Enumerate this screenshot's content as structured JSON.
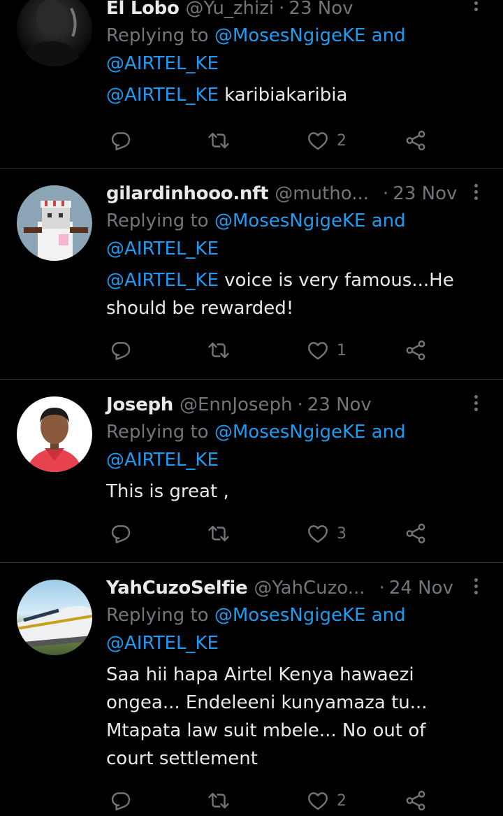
{
  "tweets": [
    {
      "name": "Èl Lobo",
      "handle": "@Yu_zhizi",
      "date": "23 Nov",
      "replying_prefix": "Replying to",
      "mention1": "@MosesNgigeKE",
      "and": "and",
      "mention2": "@AIRTEL_KE",
      "body_mention": "@AIRTEL_KE",
      "body": "karibiakaribia",
      "likes": "2"
    },
    {
      "name": "gilardinhooo.nft",
      "handle": "@mutho...",
      "date": "23 Nov",
      "replying_prefix": "Replying to",
      "mention1": "@MosesNgigeKE",
      "and": "and",
      "mention2": "@AIRTEL_KE",
      "body_mention": "@AIRTEL_KE",
      "body": "voice is very famous...He should be rewarded!",
      "likes": "1"
    },
    {
      "name": "Joseph",
      "handle": "@EnnJoseph",
      "date": "23 Nov",
      "replying_prefix": "Replying to",
      "mention1": "@MosesNgigeKE",
      "and": "and",
      "mention2": "@AIRTEL_KE",
      "body_mention": "",
      "body": "This is great ,",
      "likes": "3"
    },
    {
      "name": "YahCuzoSelfie",
      "handle": "@YahCuzo...",
      "date": "24 Nov",
      "replying_prefix": "Replying to",
      "mention1": "@MosesNgigeKE",
      "and": "and",
      "mention2": "@AIRTEL_KE",
      "body_mention": "",
      "body": "Saa hii hapa Airtel Kenya hawaezi ongea... Endeleeni kunyamaza tu... Mtapata law suit mbele... No out of court settlement",
      "likes": "2"
    }
  ],
  "icons": {
    "reply": "reply-icon",
    "retweet": "retweet-icon",
    "like": "heart-icon",
    "share": "share-icon",
    "more": "more-icon"
  },
  "colors": {
    "background": "#000000",
    "text": "#e7e9ea",
    "secondary": "#71767b",
    "link": "#1d9bf0",
    "divider": "#2f3336"
  }
}
